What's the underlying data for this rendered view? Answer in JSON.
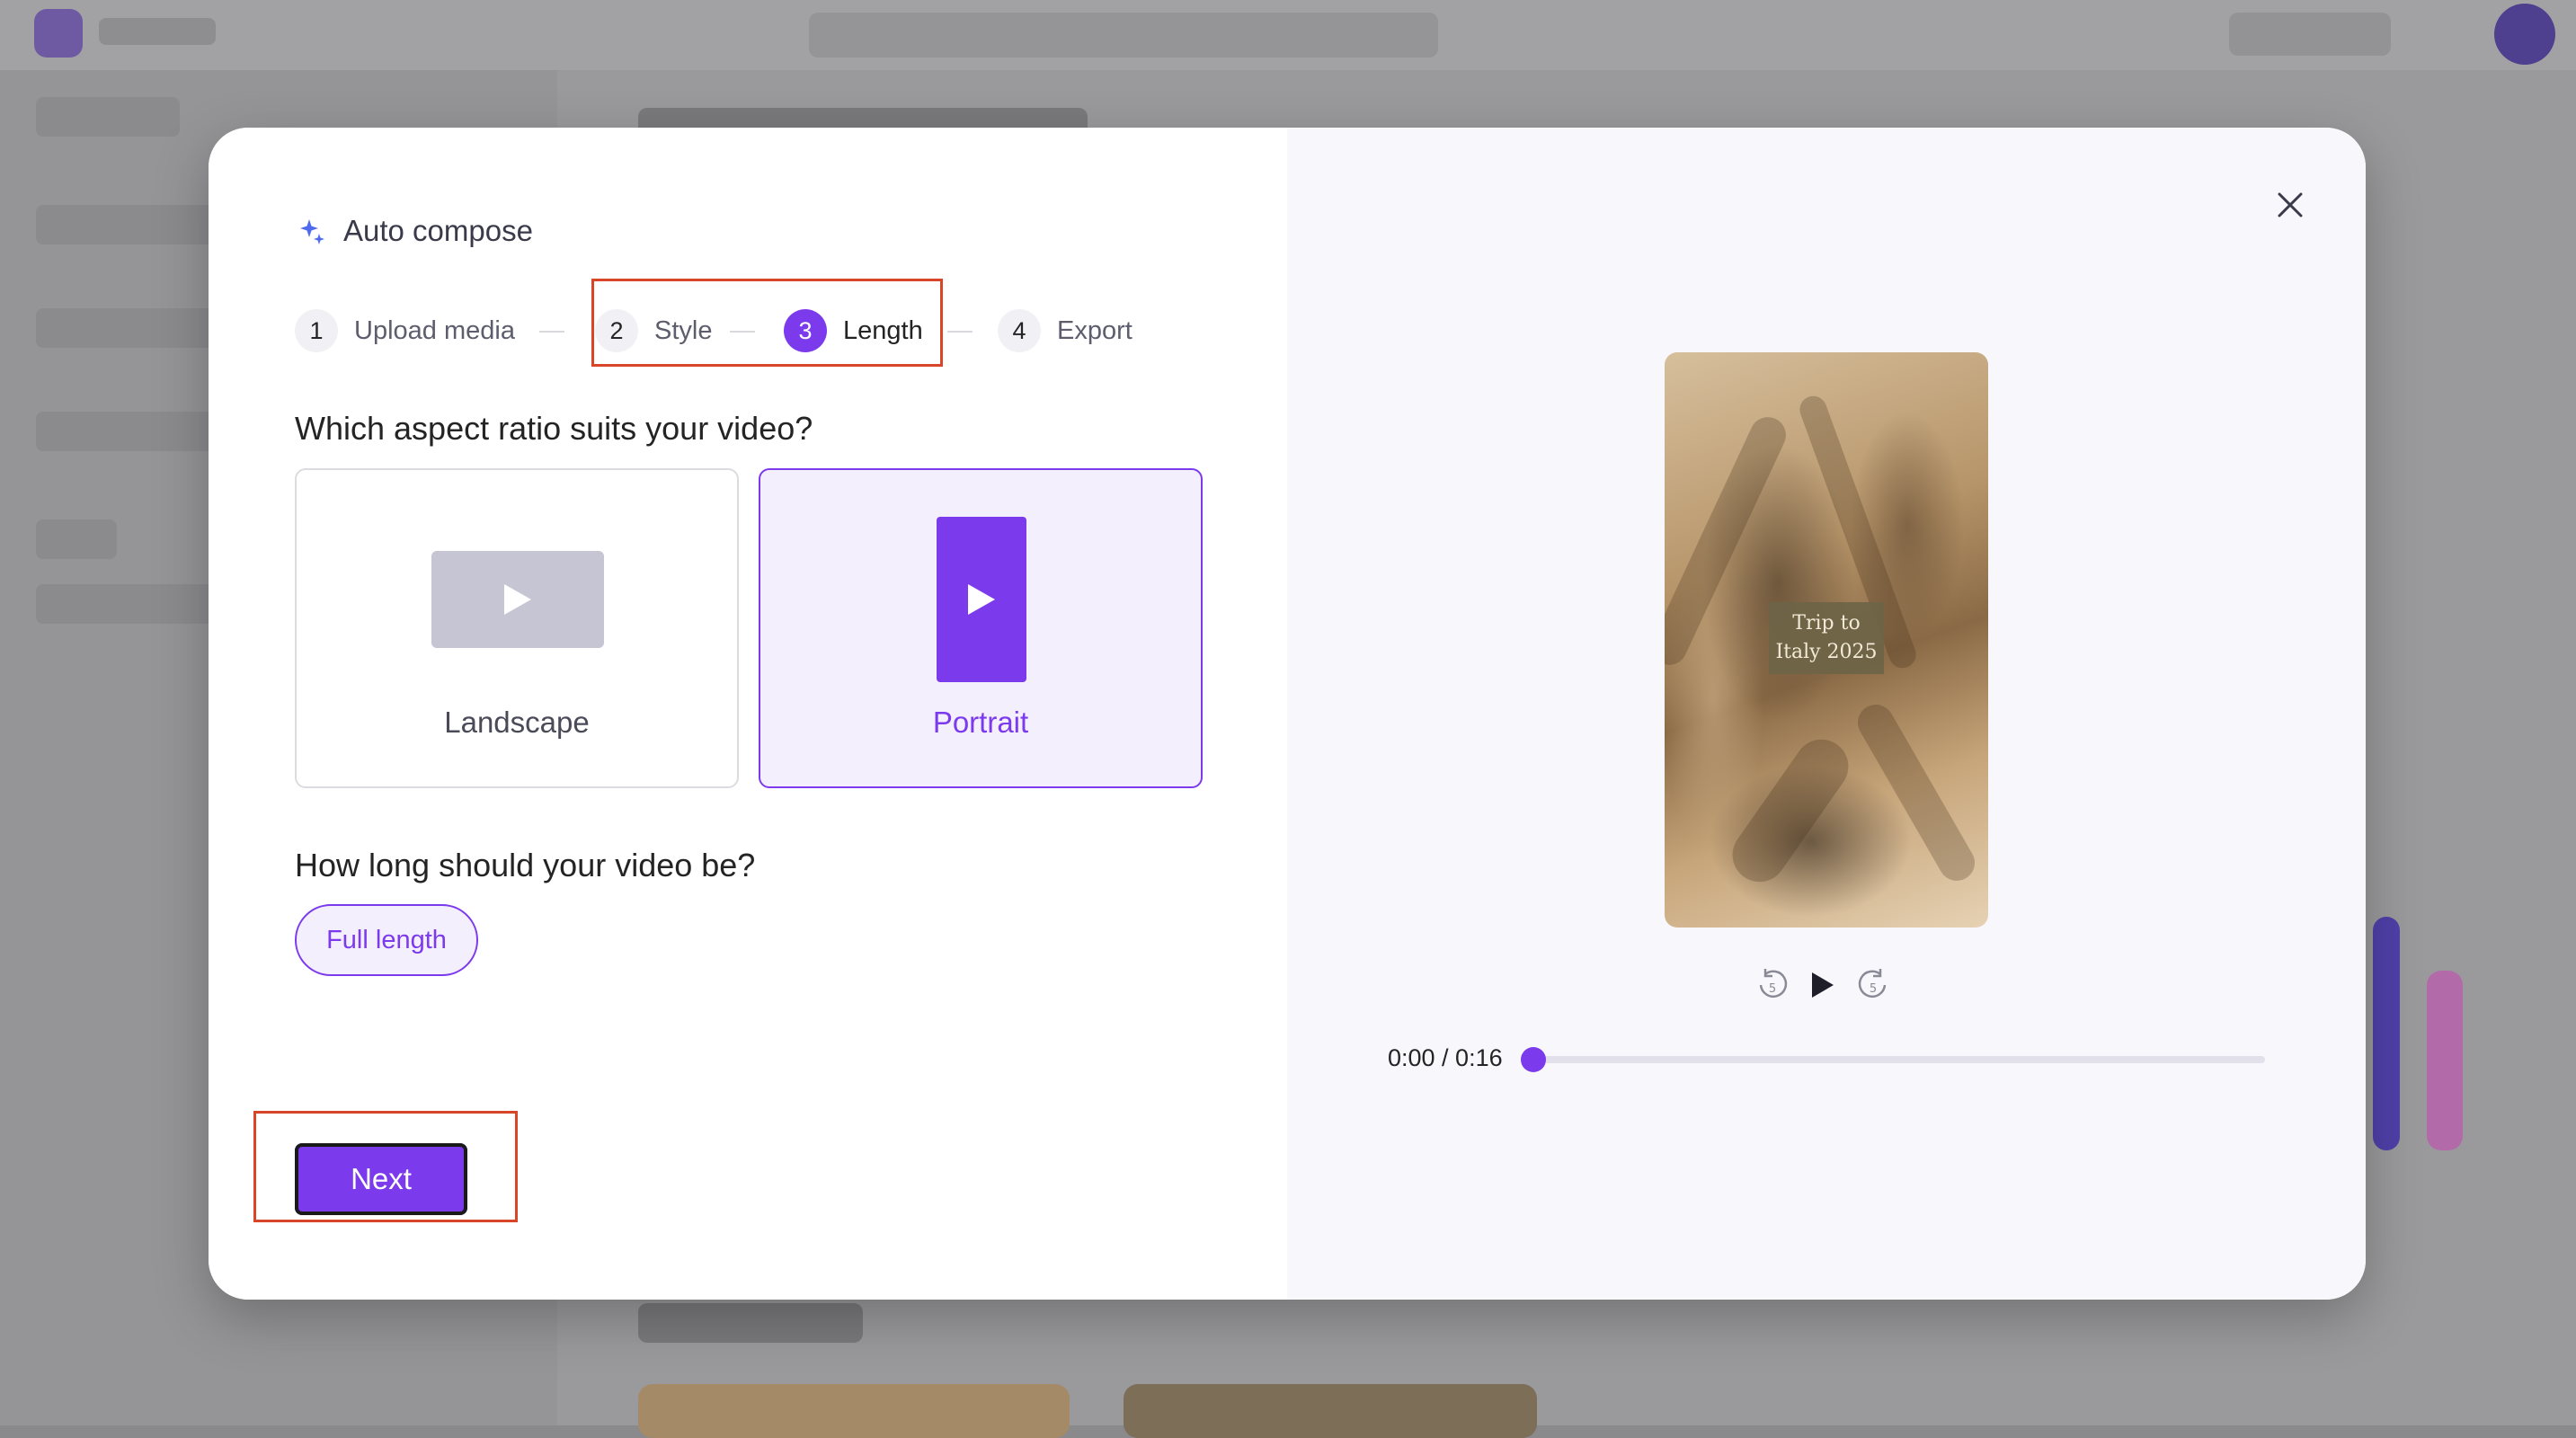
{
  "dialog": {
    "title": "Auto compose",
    "steps": [
      {
        "number": "1",
        "label": "Upload media",
        "state": "complete"
      },
      {
        "number": "2",
        "label": "Style",
        "state": "complete"
      },
      {
        "number": "3",
        "label": "Length",
        "state": "active"
      },
      {
        "number": "4",
        "label": "Export",
        "state": "upcoming"
      }
    ],
    "aspect_question": "Which aspect ratio suits your video?",
    "aspect_options": [
      {
        "label": "Landscape",
        "selected": false
      },
      {
        "label": "Portrait",
        "selected": true
      }
    ],
    "length_question": "How long should your video be?",
    "length_option": "Full length",
    "next_label": "Next"
  },
  "preview": {
    "caption_line1": "Trip to",
    "caption_line2": "Italy 2025",
    "time": "0:00 / 0:16",
    "progress_fraction": 0,
    "rewind_seconds": "5",
    "forward_seconds": "5"
  },
  "icons": {
    "title": "sparkle-icon",
    "close": "close-icon",
    "play": "play-icon",
    "rewind": "rewind-5-icon",
    "forward": "forward-5-icon"
  },
  "colors": {
    "accent": "#7c3aed",
    "accent_light": "#f4effd",
    "highlight": "#d94528",
    "preview_bg": "#f8f7fc"
  }
}
